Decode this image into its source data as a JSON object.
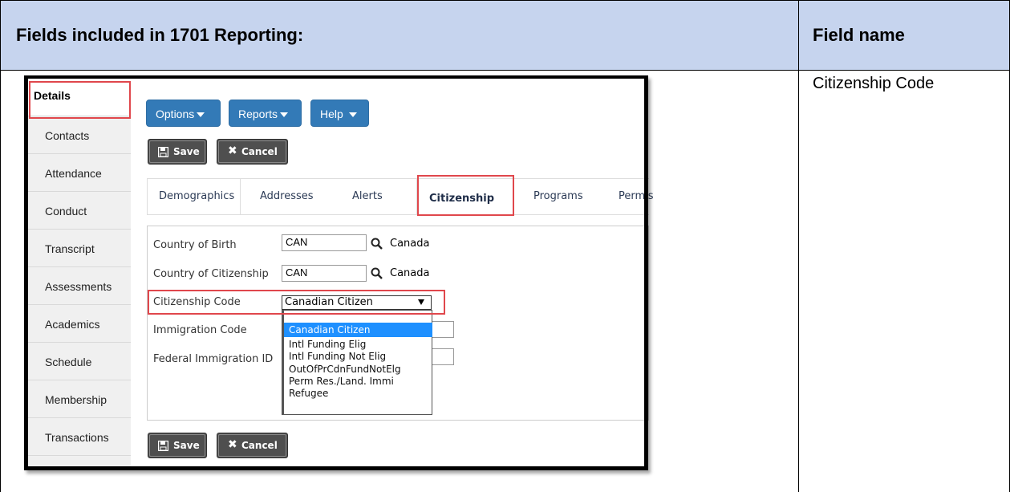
{
  "table": {
    "header_left": "Fields included in 1701 Reporting:",
    "header_right": "Field name",
    "field_name_value": "Citizenship Code"
  },
  "sidebar": {
    "items": [
      {
        "label": "Details"
      },
      {
        "label": "Contacts"
      },
      {
        "label": "Attendance"
      },
      {
        "label": "Conduct"
      },
      {
        "label": "Transcript"
      },
      {
        "label": "Assessments"
      },
      {
        "label": "Academics"
      },
      {
        "label": "Schedule"
      },
      {
        "label": "Membership"
      },
      {
        "label": "Transactions"
      }
    ]
  },
  "toolbar": {
    "options_label": "Options",
    "reports_label": "Reports",
    "help_label": "Help",
    "save_label": "Save",
    "cancel_label": "Cancel"
  },
  "tabs": [
    {
      "label": "Demographics"
    },
    {
      "label": "Addresses"
    },
    {
      "label": "Alerts"
    },
    {
      "label": "Citizenship"
    },
    {
      "label": "Programs"
    },
    {
      "label": "Permis"
    }
  ],
  "form": {
    "country_of_birth": {
      "label": "Country of Birth",
      "value": "CAN",
      "display": "Canada"
    },
    "country_of_citizenship": {
      "label": "Country of Citizenship",
      "value": "CAN",
      "display": "Canada"
    },
    "citizenship_code": {
      "label": "Citizenship Code",
      "value": "Canadian Citizen"
    },
    "immigration_code": {
      "label": "Immigration Code"
    },
    "federal_immigration_id": {
      "label": "Federal Immigration ID"
    }
  },
  "dropdown_options": [
    "Canadian Citizen",
    "Intl Funding Elig",
    "Intl Funding Not Elig",
    "OutOfPrCdnFundNotElg",
    "Perm Res./Land. Immi",
    "Refugee"
  ],
  "colors": {
    "header_bg": "#c6d4ee",
    "button_blue": "#337ab7",
    "highlight_red": "#e0474c",
    "selected_option": "#1e90ff"
  }
}
